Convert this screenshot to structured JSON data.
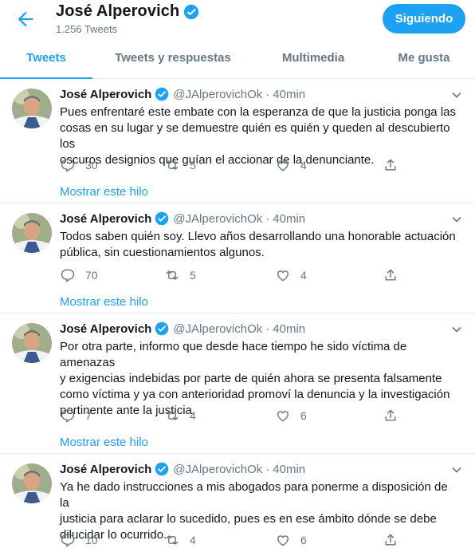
{
  "header": {
    "name": "José Alperovich",
    "tweet_count": "1.256 Tweets",
    "follow_label": "Siguiendo"
  },
  "tabs": [
    {
      "label": "Tweets",
      "active": true
    },
    {
      "label": "Tweets y respuestas",
      "active": false
    },
    {
      "label": "Multimedia",
      "active": false
    },
    {
      "label": "Me gusta",
      "active": false
    }
  ],
  "tweets": [
    {
      "name": "José Alperovich",
      "handle": "@JAlperovichOk",
      "time": "40min",
      "text_lines": [
        "Pues enfrentaré este embate con la esperanza de que la justicia ponga las",
        "cosas en su lugar y se demuestre quién es quién y queden al descubierto los",
        "oscuros designios que guían el accionar de la denunciante."
      ],
      "replies": "30",
      "retweets": "5",
      "likes": "4",
      "thread_label": "Mostrar este hilo"
    },
    {
      "name": "José Alperovich",
      "handle": "@JAlperovichOk",
      "time": "40min",
      "text_lines": [
        "Todos saben quién soy. Llevo años desarrollando una honorable actuación",
        "pública, sin cuestionamientos algunos."
      ],
      "replies": "70",
      "retweets": "5",
      "likes": "4",
      "thread_label": "Mostrar este hilo"
    },
    {
      "name": "José Alperovich",
      "handle": "@JAlperovichOk",
      "time": "40min",
      "text_lines": [
        "Por otra parte, informo que desde hace tiempo he sido víctima de amenazas",
        "y exigencias indebidas por parte de quién ahora se presenta falsamente",
        "como víctima y ya con anterioridad promoví la denuncia y la investigación",
        "pertinente ante la justicia."
      ],
      "replies": "7",
      "retweets": "4",
      "likes": "6",
      "thread_label": "Mostrar este hilo"
    },
    {
      "name": "José Alperovich",
      "handle": "@JAlperovichOk",
      "time": "40min",
      "text_lines": [
        "Ya he dado instrucciones a mis abogados para ponerme a disposición de la",
        "justicia para aclarar lo sucedido, pues es en ese ámbito dónde se debe",
        "dilucidar lo ocurrido."
      ],
      "replies": "10",
      "retweets": "4",
      "likes": "6"
    }
  ],
  "colors": {
    "accent": "#1da1f2",
    "text": "#14171a",
    "muted": "#657786",
    "divider": "#e6ecf0"
  },
  "icons": [
    "back-arrow-icon",
    "verified-badge-icon",
    "chevron-down-icon",
    "reply-icon",
    "retweet-icon",
    "like-icon",
    "share-icon"
  ]
}
